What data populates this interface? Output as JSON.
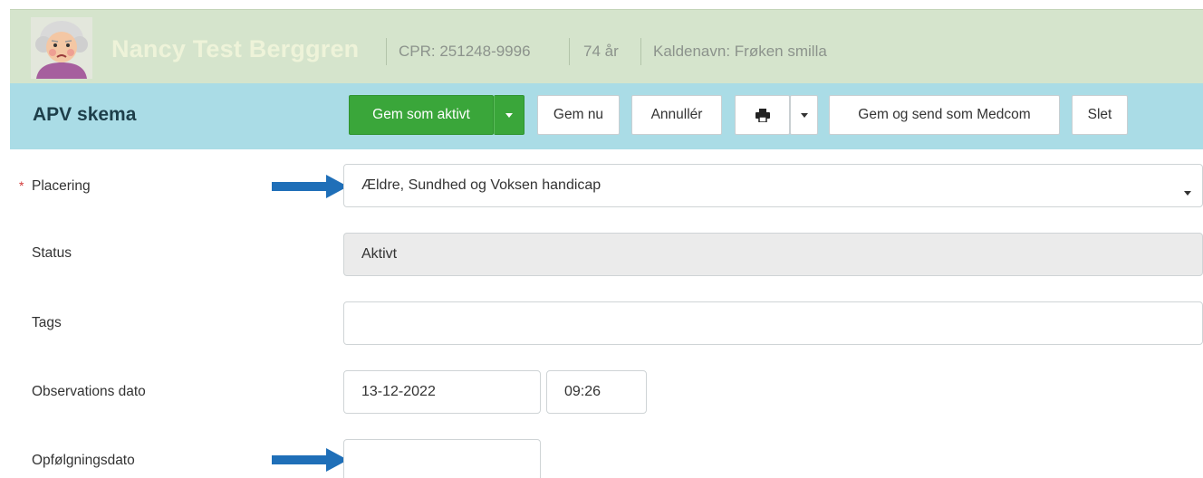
{
  "patient": {
    "name": "Nancy Test Berggren",
    "cpr": "CPR: 251248-9996",
    "age": "74 år",
    "nickname": "Kaldenavn: Frøken smilla"
  },
  "toolbar": {
    "title": "APV skema",
    "save_active_label": "Gem som aktivt",
    "save_now_label": "Gem nu",
    "cancel_label": "Annullér",
    "send_medcom_label": "Gem og send som Medcom",
    "delete_label": "Slet"
  },
  "form": {
    "required_marker": "*",
    "placering": {
      "label": "Placering",
      "value": "Ældre, Sundhed og Voksen handicap"
    },
    "status": {
      "label": "Status",
      "value": "Aktivt"
    },
    "tags": {
      "label": "Tags",
      "value": ""
    },
    "observation": {
      "label": "Observations dato",
      "date": "13-12-2022",
      "time": "09:26"
    },
    "followup": {
      "label": "Opfølgningsdato",
      "value": ""
    }
  },
  "colors": {
    "patient_header_bg": "#d5e4cc",
    "toolbar_bg": "#aadce6",
    "primary_button": "#3aa63a",
    "annotation_arrow": "#1f6fb8",
    "required_marker": "#d23a3a"
  },
  "icons": {
    "avatar": "elderly-woman-avatar",
    "print": "printer-icon",
    "dropdown": "chevron-down-icon",
    "annotation": "arrow-right-icon"
  }
}
